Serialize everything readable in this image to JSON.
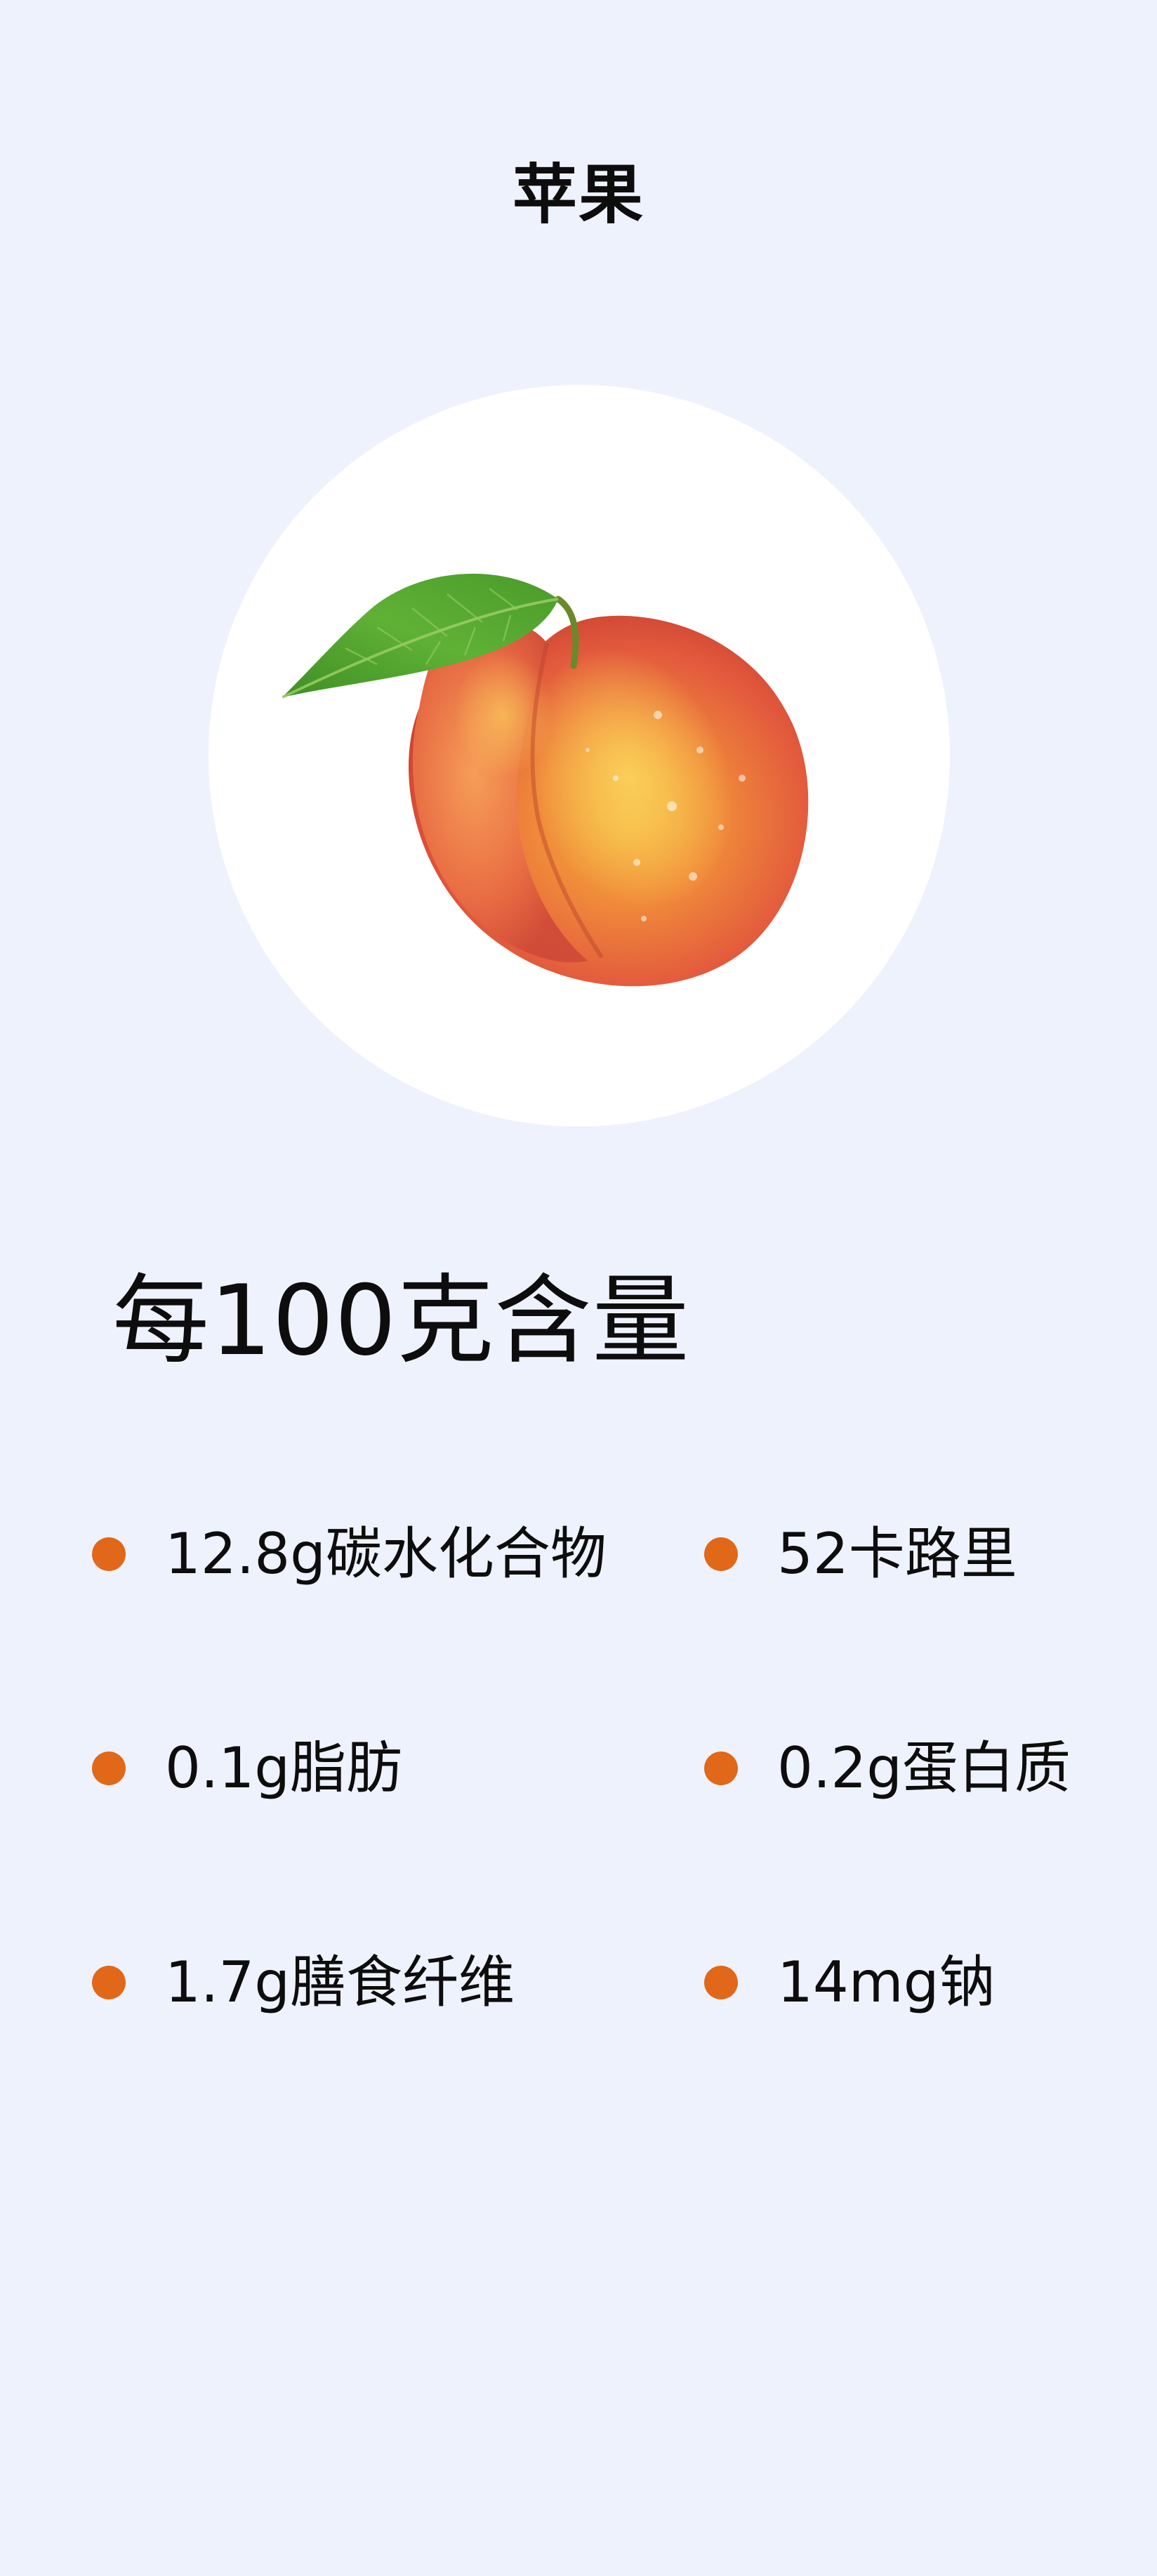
{
  "page": {
    "title": "苹果",
    "background_color": "#eef2fd"
  },
  "hero_image": {
    "icon": "peach-with-leaf-image",
    "circle_color": "#ffffff"
  },
  "nutrition": {
    "heading": "每100克含量",
    "bullet_color": "#e06818",
    "items": [
      {
        "label": "12.8g碳水化合物"
      },
      {
        "label": "52卡路里"
      },
      {
        "label": "0.1g脂肪"
      },
      {
        "label": "0.2g蛋白质"
      },
      {
        "label": "1.7g膳食纤维"
      },
      {
        "label": "14mg钠"
      }
    ]
  }
}
